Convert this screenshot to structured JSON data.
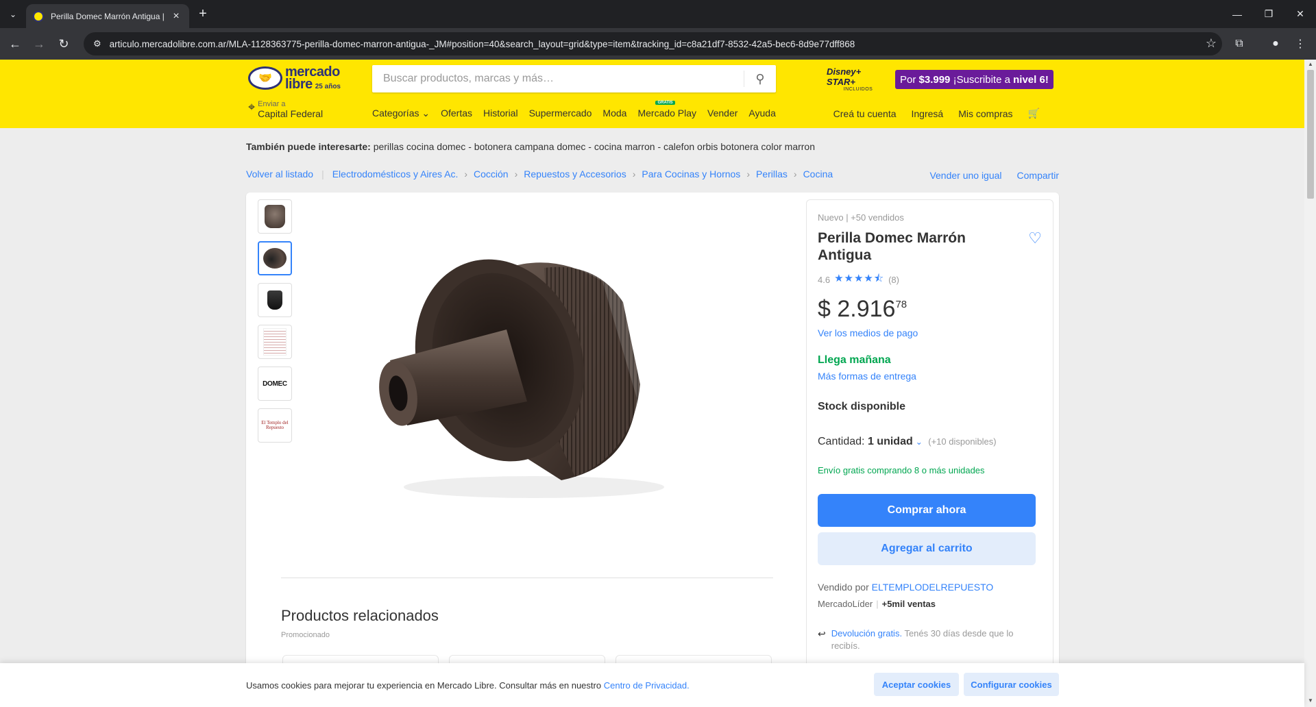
{
  "browser": {
    "tab_title": "Perilla Domec Marrón Antigua |",
    "url": "articulo.mercadolibre.com.ar/MLA-1128363775-perilla-domec-marron-antigua-_JM#position=40&search_layout=grid&type=item&tracking_id=c8a21df7-8532-42a5-bec6-8d9e77dff868"
  },
  "header": {
    "logo_line1": "mercado",
    "logo_line2": "libre",
    "logo_line3": "25 años",
    "search_placeholder": "Buscar productos, marcas y más…",
    "disney_line1": "Disney+ STAR+",
    "disney_line2": "INCLUIDOS",
    "promo_prefix": "Por",
    "promo_price": "$3.999",
    "promo_text": "¡Suscribite a",
    "promo_level": "nivel 6!",
    "location_label": "Enviar a",
    "location_value": "Capital Federal",
    "nav": [
      "Categorías ⌄",
      "Ofertas",
      "Historial",
      "Supermercado",
      "Moda",
      "Mercado Play",
      "Vender",
      "Ayuda"
    ],
    "nav_badge": "GRATIS",
    "user_nav": [
      "Creá tu cuenta",
      "Ingresá",
      "Mis compras"
    ]
  },
  "related_searches": {
    "label": "También puede interesarte:",
    "text": "perillas cocina domec - botonera campana domec - cocina marron - calefon orbis botonera color marron"
  },
  "breadcrumb": {
    "back": "Volver al listado",
    "items": [
      "Electrodomésticos y Aires Ac.",
      "Cocción",
      "Repuestos y Accesorios",
      "Para Cocinas y Hornos",
      "Perillas",
      "Cocina"
    ],
    "sell_same": "Vender uno igual",
    "share": "Compartir"
  },
  "thumbs": {
    "logo_text": "DOMEC",
    "templo_text": "El Templo del Repuesto"
  },
  "product": {
    "condition": "Nuevo  |  +50 vendidos",
    "title": "Perilla Domec Marrón Antigua",
    "rating": "4.6",
    "rating_value": 4.6,
    "stars": "★★★★⯪",
    "reviews": "(8)",
    "price_currency": "$",
    "price_int": "2.916",
    "price_cents": "78",
    "payment_link": "Ver los medios de pago",
    "arrival": "Llega mañana",
    "more_delivery": "Más formas de entrega",
    "stock": "Stock disponible",
    "qty_label": "Cantidad:",
    "qty_value": "1 unidad",
    "qty_avail": "(+10 disponibles)",
    "free_shipping": "Envío gratis comprando 8 o más unidades",
    "buy_now": "Comprar ahora",
    "add_cart": "Agregar al carrito",
    "seller_label": "Vendido por",
    "seller_name": "ELTEMPLODELREPUESTO",
    "leader": "MercadoLíder",
    "sales": "+5mil ventas",
    "return_link": "Devolución gratis.",
    "return_text": "Tenés 30 días desde que lo recibís."
  },
  "related_products": {
    "title": "Productos relacionados",
    "subtitle": "Promocionado"
  },
  "cookies": {
    "text": "Usamos cookies para mejorar tu experiencia en Mercado Libre. Consultar más en nuestro",
    "link": "Centro de Privacidad.",
    "accept": "Aceptar cookies",
    "configure": "Configurar cookies"
  },
  "colors": {
    "brand_yellow": "#ffe600",
    "accent_blue": "#3483fa",
    "success_green": "#00a650",
    "promo_purple": "#6a1b9a"
  }
}
